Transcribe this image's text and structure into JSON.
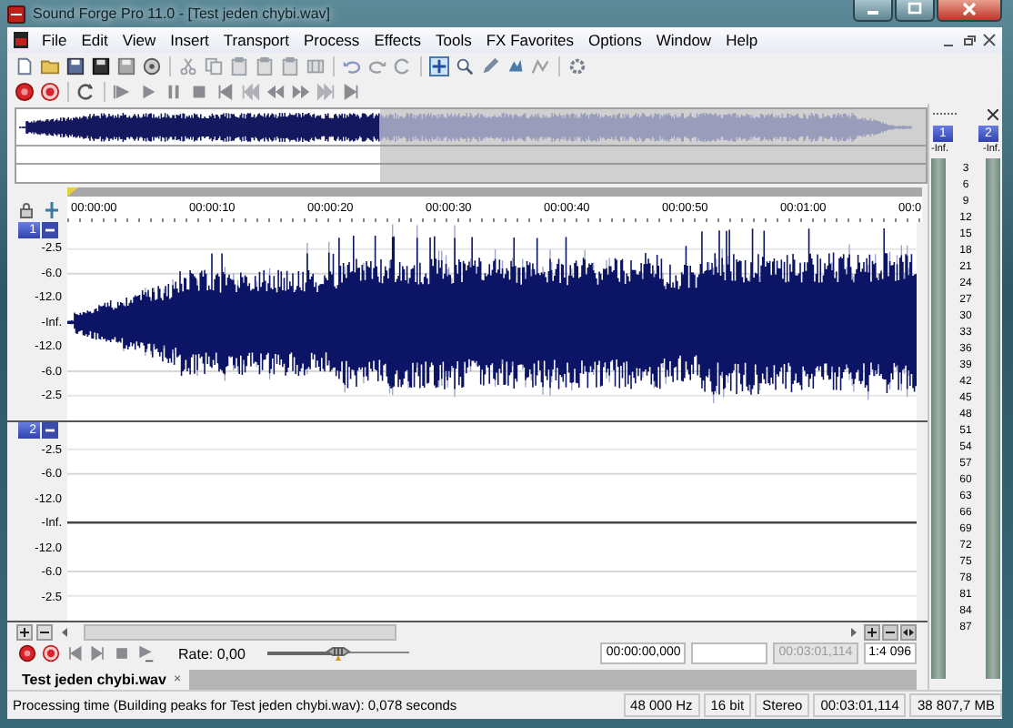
{
  "window": {
    "title": "Sound Forge Pro 11.0 - [Test jeden chybi.wav]"
  },
  "menu": [
    "File",
    "Edit",
    "View",
    "Insert",
    "Transport",
    "Process",
    "Effects",
    "Tools",
    "FX Favorites",
    "Options",
    "Window",
    "Help"
  ],
  "ruler": {
    "ticks": [
      "00:00:00",
      "00:00:10",
      "00:00:20",
      "00:00:30",
      "00:00:40",
      "00:00:50",
      "00:01:00",
      "00:0"
    ]
  },
  "channels": [
    {
      "number": "1",
      "signal": true,
      "scale": [
        "-2.5",
        "-6.0",
        "-12.0",
        "-Inf.",
        "-12.0",
        "-6.0",
        "-2.5"
      ]
    },
    {
      "number": "2",
      "signal": false,
      "scale": [
        "-2.5",
        "-6.0",
        "-12.0",
        "-Inf.",
        "-12.0",
        "-6.0",
        "-2.5"
      ]
    }
  ],
  "transport": {
    "rate": "Rate: 0,00",
    "rate_slider": {
      "level": 0.5
    }
  },
  "time_fields": [
    {
      "value": "00:00:00,000",
      "disabled": false
    },
    {
      "disabled": false
    },
    {
      "value": "00:03:01,114",
      "disabled": true
    },
    {
      "value": "1:4 096",
      "disabled": false
    }
  ],
  "tabs": [
    {
      "label": "Test jeden chybi.wav",
      "close": "×",
      "selected": true
    }
  ],
  "meters": {
    "channels": [
      {
        "number": "1",
        "peak": "-Inf."
      },
      {
        "number": "2",
        "peak": "-Inf."
      }
    ],
    "scale": [
      "3",
      "6",
      "9",
      "12",
      "15",
      "18",
      "21",
      "24",
      "27",
      "30",
      "33",
      "36",
      "39",
      "42",
      "45",
      "48",
      "51",
      "54",
      "57",
      "60",
      "63",
      "66",
      "69",
      "72",
      "75",
      "78",
      "81",
      "84",
      "87"
    ]
  },
  "status_bar": {
    "message": "Processing time (Building peaks for Test jeden chybi.wav): 0,078 seconds",
    "panes": [
      "48 000 Hz",
      "16 bit",
      "Stereo",
      "00:03:01,114",
      "38 807,7 MB"
    ]
  }
}
